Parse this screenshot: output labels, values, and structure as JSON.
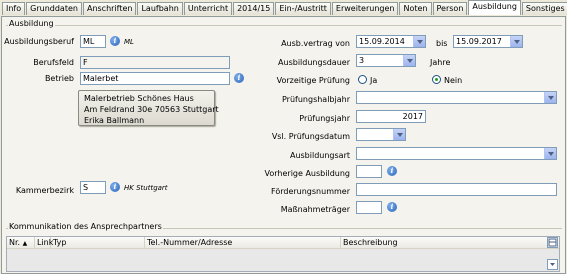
{
  "tabs": [
    {
      "label": "Info",
      "active": false
    },
    {
      "label": "Grunddaten",
      "active": false
    },
    {
      "label": "Anschriften",
      "active": false
    },
    {
      "label": "Laufbahn",
      "active": false
    },
    {
      "label": "Unterricht",
      "active": false
    },
    {
      "label": "2014/15",
      "active": false
    },
    {
      "label": "Ein-/Austritt",
      "active": false
    },
    {
      "label": "Erweiterungen",
      "active": false
    },
    {
      "label": "Noten",
      "active": false
    },
    {
      "label": "Person",
      "active": false
    },
    {
      "label": "Ausbildung",
      "active": true
    },
    {
      "label": "Sonstiges",
      "active": false
    }
  ],
  "group_ausbildung": {
    "title": "Ausbildung"
  },
  "left": {
    "ausbildungsberuf": {
      "label": "Ausbildungsberuf",
      "value": "ML",
      "hint": "ML"
    },
    "berufsfeld": {
      "label": "Berufsfeld",
      "value": "F"
    },
    "betrieb": {
      "label": "Betrieb",
      "value": "Malerbet"
    },
    "betrieb_popup": {
      "line1": "Malerbetrieb Schönes Haus",
      "line2": "Am Feldrand 30e 70563 Stuttgart",
      "line3": "Erika Ballmann"
    },
    "kammerbezirk": {
      "label": "Kammerbezirk",
      "value": "S",
      "hint": "HK Stuttgart"
    }
  },
  "right": {
    "vertrag": {
      "label": "Ausb.vertrag von",
      "from": "15.09.2014",
      "to_label": "bis",
      "to": "15.09.2017"
    },
    "dauer": {
      "label": "Ausbildungsdauer",
      "value": "3",
      "unit": "Jahre"
    },
    "vorzeitig": {
      "label": "Vorzeitige Prüfung",
      "opt_yes": "Ja",
      "opt_no": "Nein",
      "selected": "Nein"
    },
    "pruefungshalbjahr": {
      "label": "Prüfungshalbjahr",
      "value": ""
    },
    "pruefungsjahr": {
      "label": "Prüfungsjahr",
      "value": "2017"
    },
    "pruefungsdatum": {
      "label": "Vsl. Prüfungsdatum",
      "value": ""
    },
    "ausbildungsart": {
      "label": "Ausbildungsart",
      "value": ""
    },
    "vorherige": {
      "label": "Vorherige Ausbildung",
      "value": ""
    },
    "foerderung": {
      "label": "Förderungsnummer",
      "value": ""
    },
    "massnahme": {
      "label": "Maßnahmeträger",
      "value": ""
    }
  },
  "group_kommunikation": {
    "title": "Kommunikation des Ansprechpartners"
  },
  "table": {
    "columns": [
      "Nr.",
      "Link",
      "Typ",
      "Tel.-Nummer/Adresse",
      "Beschreibung"
    ],
    "rows": []
  },
  "colors": {
    "accent": "#7f9db9",
    "panel": "#f4f3ee",
    "info": "#2a62b8"
  }
}
